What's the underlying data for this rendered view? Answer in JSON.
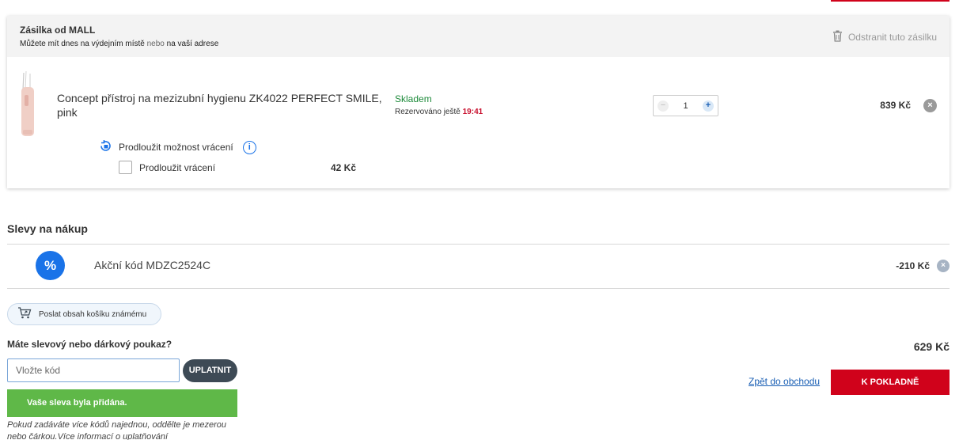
{
  "shipment": {
    "title": "Zásilka od MALL",
    "subtitle_prefix": "Můžete mít dnes na výdejním místě",
    "subtitle_or": "nebo",
    "subtitle_suffix": "na vaší adrese",
    "remove_label": "Odstranit tuto zásilku"
  },
  "item": {
    "name": "Concept přístroj na mezizubní hygienu ZK4022 PERFECT SMILE, pink",
    "stock_status": "Skladem",
    "reserved_label": "Rezervováno ještě",
    "reserved_time": "19:41",
    "quantity": "1",
    "minus": "−",
    "plus": "+",
    "price": "839 Kč",
    "remove_glyph": "×"
  },
  "return_extension": {
    "title": "Prodloužit možnost vrácení",
    "info_glyph": "i",
    "option_label": "Prodloužit vrácení",
    "option_price": "42 Kč"
  },
  "discounts": {
    "title": "Slevy na nákup",
    "badge": "%",
    "code_label": "Akční kód MDZC2524C",
    "amount": "-210 Kč",
    "remove_glyph": "×"
  },
  "share": {
    "label": "Poslat obsah košíku známému"
  },
  "voucher": {
    "title": "Máte slevový nebo dárkový poukaz?",
    "placeholder": "Vložte kód",
    "apply_label": "UPLATNIT",
    "success_message": "Vaše sleva byla přidána.",
    "hint": "Pokud zadáváte více kódů najednou, oddělte je mezerou nebo čárkou.Více informací o uplatňování"
  },
  "summary": {
    "total": "629 Kč",
    "back_link": "Zpět do obchodu",
    "checkout_label": "K POKLADNĚ"
  },
  "colors": {
    "accent_red": "#d0021b",
    "link_blue": "#1a5fb4",
    "success_green": "#5fb848",
    "stock_green": "#1d8a3a"
  }
}
